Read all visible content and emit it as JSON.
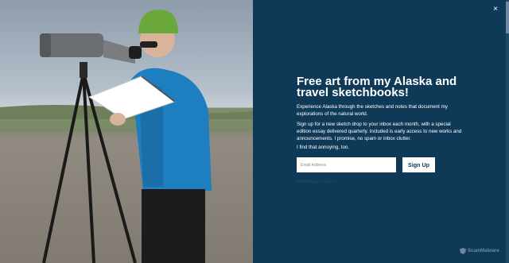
{
  "photo": {
    "alt": "Woman in blue jacket and green hat sketching beside a spotting scope on a tripod"
  },
  "modal": {
    "close_icon": "×",
    "title": "Free art from my Alaska and travel sketchbooks!",
    "paragraph_1": "Experience Alaska through the sketches and notes that document my explorations of the natural world.",
    "paragraph_2": "Sign up for a new sketch drop to your inbox each month, with a special edition essay delivered quarterly. Included is early access to new works and announcements. I promise, no spam or inbox clutter.",
    "paragraph_3": "I find that annoying, too.",
    "email_placeholder": "Email Address",
    "signup_label": "Sign Up",
    "fine_print": "Marketing permissions",
    "brand_label": "ScamMalware"
  },
  "colors": {
    "panel_bg": "#0f3a57",
    "button_text": "#0f3a57",
    "brand": "#6e8ba3"
  }
}
